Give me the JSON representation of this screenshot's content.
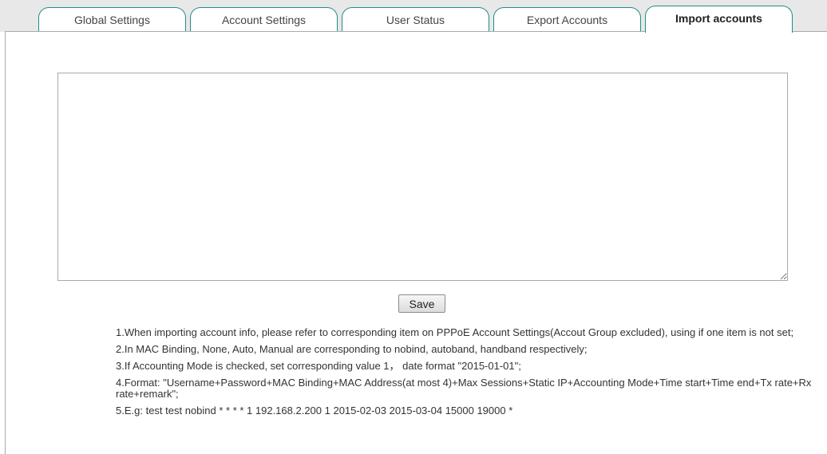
{
  "tabs": [
    {
      "label": "Global Settings",
      "active": false
    },
    {
      "label": "Account Settings",
      "active": false
    },
    {
      "label": "User Status",
      "active": false
    },
    {
      "label": "Export Accounts",
      "active": false
    },
    {
      "label": "Import accounts",
      "active": true
    }
  ],
  "import": {
    "textarea_value": "",
    "save_label": "Save"
  },
  "notes": [
    "1.When importing account info, please refer to corresponding item on PPPoE Account Settings(Accout Group excluded), using if one item is not set;",
    "2.In MAC Binding, None, Auto, Manual are corresponding to nobind, autoband, handband respectively;",
    "3.If Accounting Mode is checked, set corresponding value 1， date format \"2015-01-01\";",
    "4.Format: \"Username+Password+MAC Binding+MAC Address(at most 4)+Max Sessions+Static IP+Accounting Mode+Time start+Time end+Tx rate+Rx rate+remark\";",
    "5.E.g: test test nobind * * * * 1 192.168.2.200 1 2015-02-03 2015-03-04 15000 19000 *"
  ],
  "colors": {
    "tab_border": "#1e8e86",
    "tabbar_bg": "#e8e8e8"
  }
}
